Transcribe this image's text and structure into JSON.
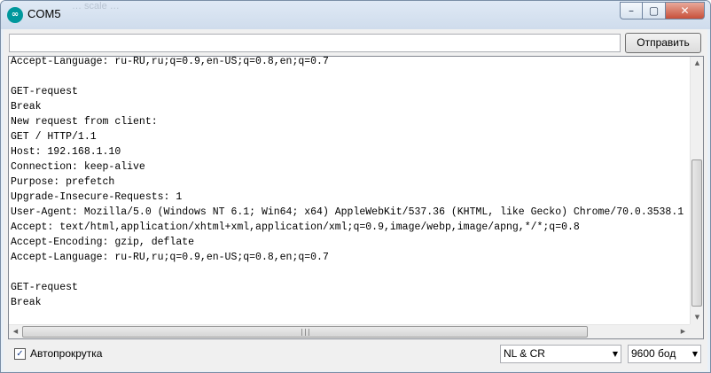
{
  "window": {
    "title": "COM5",
    "icon_text": "∞",
    "background_text": "…    scale    …"
  },
  "controls": {
    "minimize": "–",
    "maximize": "▢",
    "close": "✕"
  },
  "send": {
    "input_value": "",
    "button_label": "Отправить"
  },
  "output": {
    "lines": [
      "Accept-Language: ru-RU,ru;q=0.9,en-US;q=0.8,en;q=0.7",
      "",
      "GET-request",
      "Break",
      "New request from client:",
      "GET / HTTP/1.1",
      "Host: 192.168.1.10",
      "Connection: keep-alive",
      "Purpose: prefetch",
      "Upgrade-Insecure-Requests: 1",
      "User-Agent: Mozilla/5.0 (Windows NT 6.1; Win64; x64) AppleWebKit/537.36 (KHTML, like Gecko) Chrome/70.0.3538.1",
      "Accept: text/html,application/xhtml+xml,application/xml;q=0.9,image/webp,image/apng,*/*;q=0.8",
      "Accept-Encoding: gzip, deflate",
      "Accept-Language: ru-RU,ru;q=0.9,en-US;q=0.8,en;q=0.7",
      "",
      "GET-request",
      "Break"
    ]
  },
  "scrollbars": {
    "up_arrow": "▲",
    "down_arrow": "▼",
    "left_arrow": "◀",
    "right_arrow": "▶",
    "grip": "|||"
  },
  "footer": {
    "autoscroll_label": "Автопрокрутка",
    "autoscroll_checked": true,
    "checkmark": "✓",
    "line_ending": "NL & CR",
    "baud_rate": "9600 бод",
    "dropdown_arrow": "▼"
  },
  "colors": {
    "accent_icon": "#00979c",
    "close_button": "#c7503a",
    "window_frame": "#dfe9f5"
  }
}
